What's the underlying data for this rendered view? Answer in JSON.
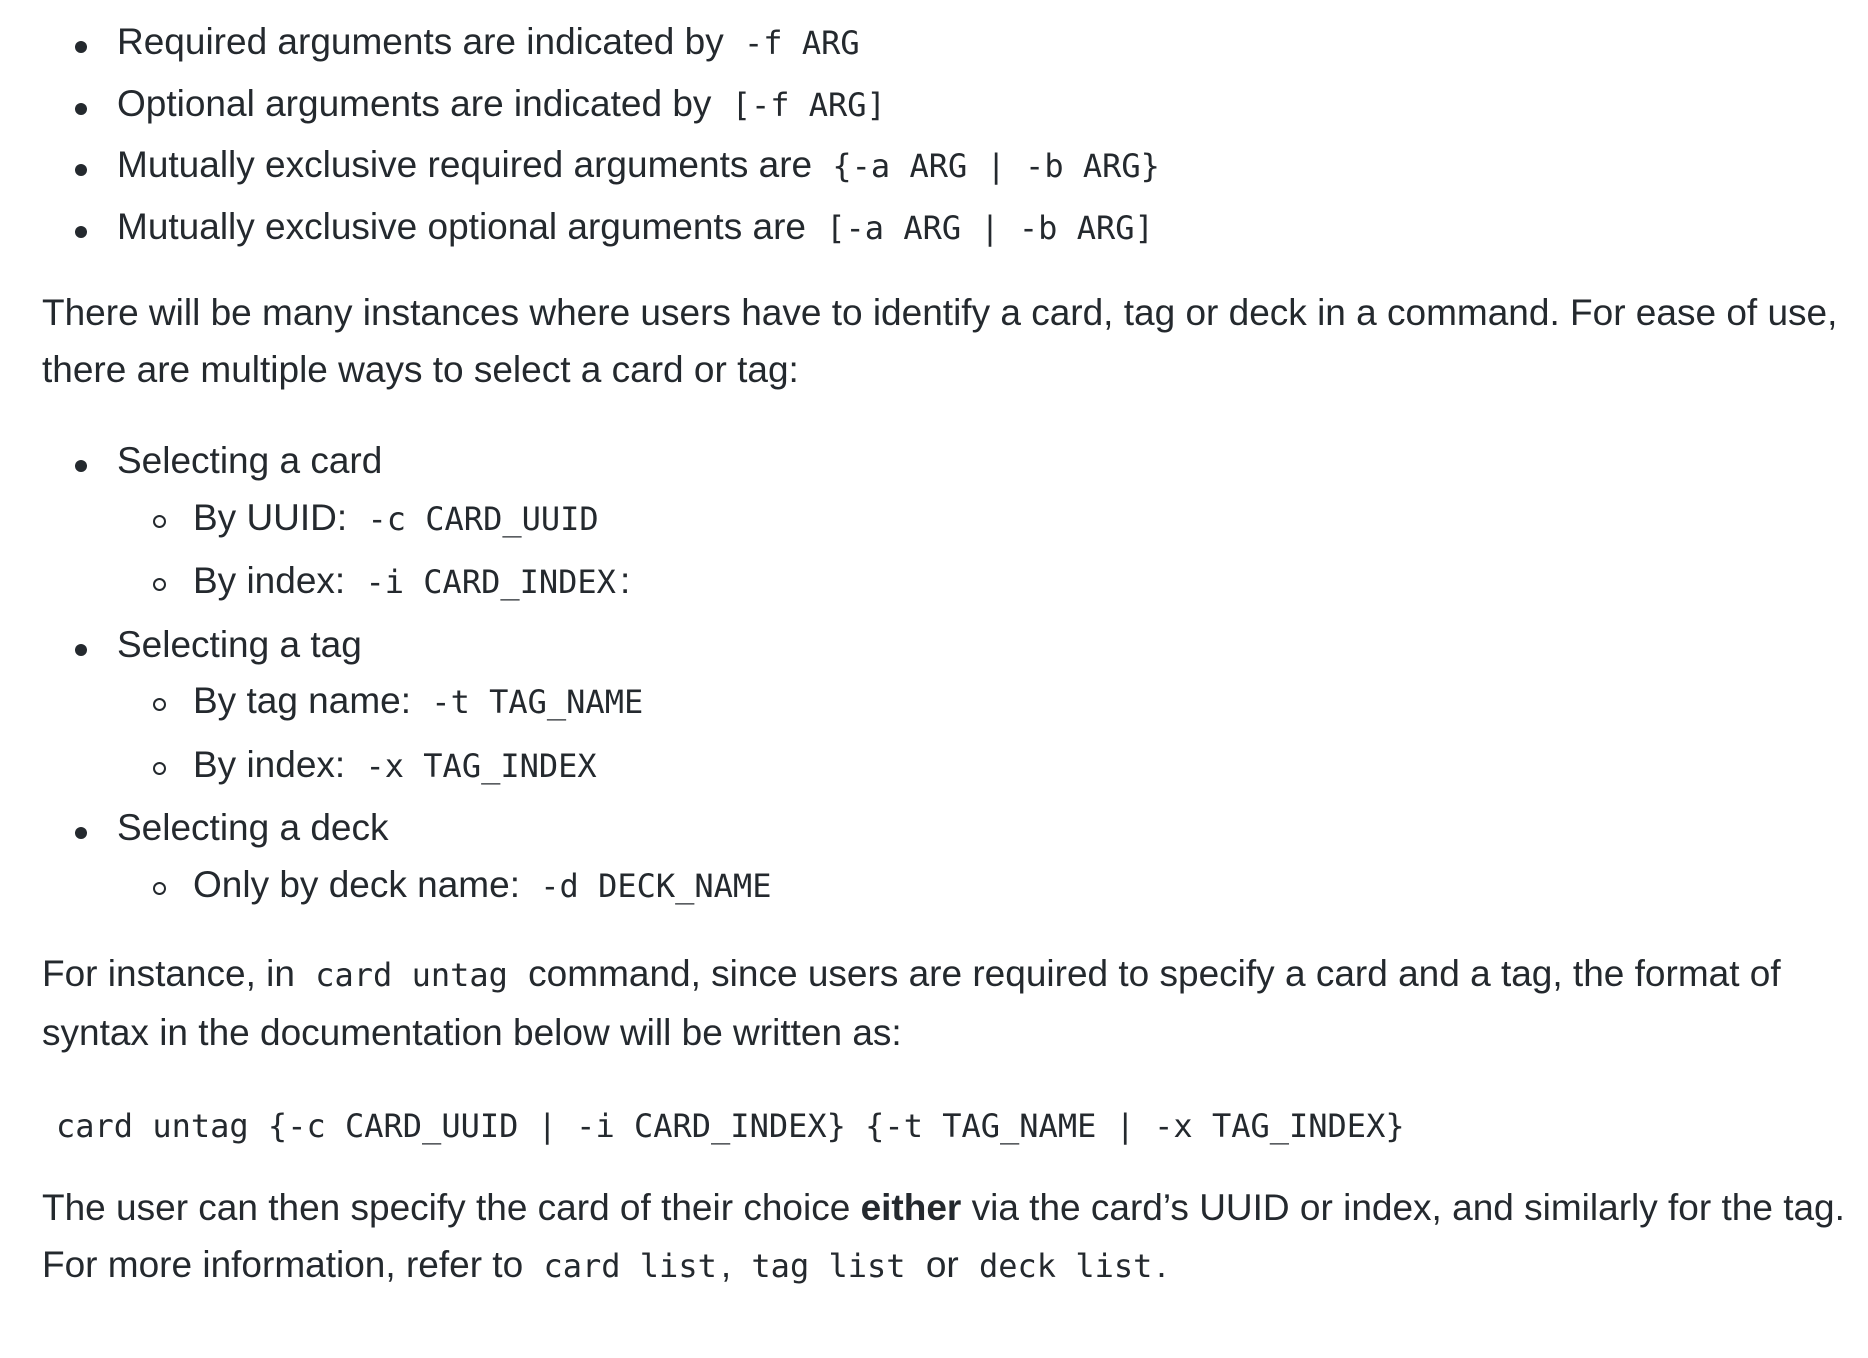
{
  "syntax_list": [
    {
      "text": "Required arguments are indicated by",
      "code": "-f ARG"
    },
    {
      "text": "Optional arguments are indicated by",
      "code": "[-f ARG]"
    },
    {
      "text": "Mutually exclusive required arguments are",
      "code": "{-a ARG | -b ARG}"
    },
    {
      "text": "Mutually exclusive optional arguments are",
      "code": "[-a ARG | -b ARG]"
    }
  ],
  "intro_paragraph": "There will be many instances where users have to identify a card, tag or deck in a command. For ease of use, there are multiple ways to select a card or tag:",
  "selection_list": [
    {
      "label": "Selecting a card",
      "items": [
        {
          "text": "By UUID:",
          "code": "-c CARD_UUID",
          "suffix": ""
        },
        {
          "text": "By index:",
          "code": "-i CARD_INDEX",
          "suffix": ":"
        }
      ]
    },
    {
      "label": "Selecting a tag",
      "items": [
        {
          "text": "By tag name:",
          "code": "-t TAG_NAME",
          "suffix": ""
        },
        {
          "text": "By index:",
          "code": "-x TAG_INDEX",
          "suffix": ""
        }
      ]
    },
    {
      "label": "Selecting a deck",
      "items": [
        {
          "text": "Only by deck name:",
          "code": "-d DECK_NAME",
          "suffix": ""
        }
      ]
    }
  ],
  "instance_paragraph": {
    "before": "For instance, in",
    "code": "card untag",
    "after": "command, since users are required to specify a card and a tag, the format of syntax in the documentation below will be written as:"
  },
  "code_block": "card untag {-c CARD_UUID | -i CARD_INDEX} {-t TAG_NAME | -x TAG_INDEX}",
  "final_paragraph": {
    "before": "The user can then specify the card of their choice",
    "bold": "either",
    "middle": "via the card’s UUID or index, and similarly for the tag. For more information, refer to",
    "code1": "card list",
    "sep1": ",",
    "code2": "tag list",
    "or": "or",
    "code3": "deck list",
    "end": "."
  }
}
